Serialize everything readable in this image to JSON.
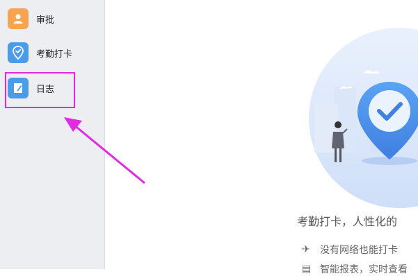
{
  "sidebar": {
    "items": [
      {
        "label": "审批",
        "icon": "approval-person-icon",
        "color": "#f6a450"
      },
      {
        "label": "考勤打卡",
        "icon": "location-pin-check-icon",
        "color": "#4a9be8"
      },
      {
        "label": "日志",
        "icon": "notebook-pen-icon",
        "color": "#4a9be8"
      }
    ]
  },
  "main": {
    "hero_title": "考勤打卡，人性化的",
    "features": [
      {
        "icon": "airplane-icon",
        "text": "没有网络也能打卡"
      },
      {
        "icon": "report-icon",
        "text": "智能报表，实时查看"
      }
    ]
  },
  "colors": {
    "highlight": "#e12be3",
    "sidebar_bg": "#edeef2",
    "pin_blue": "#4a90e8"
  }
}
